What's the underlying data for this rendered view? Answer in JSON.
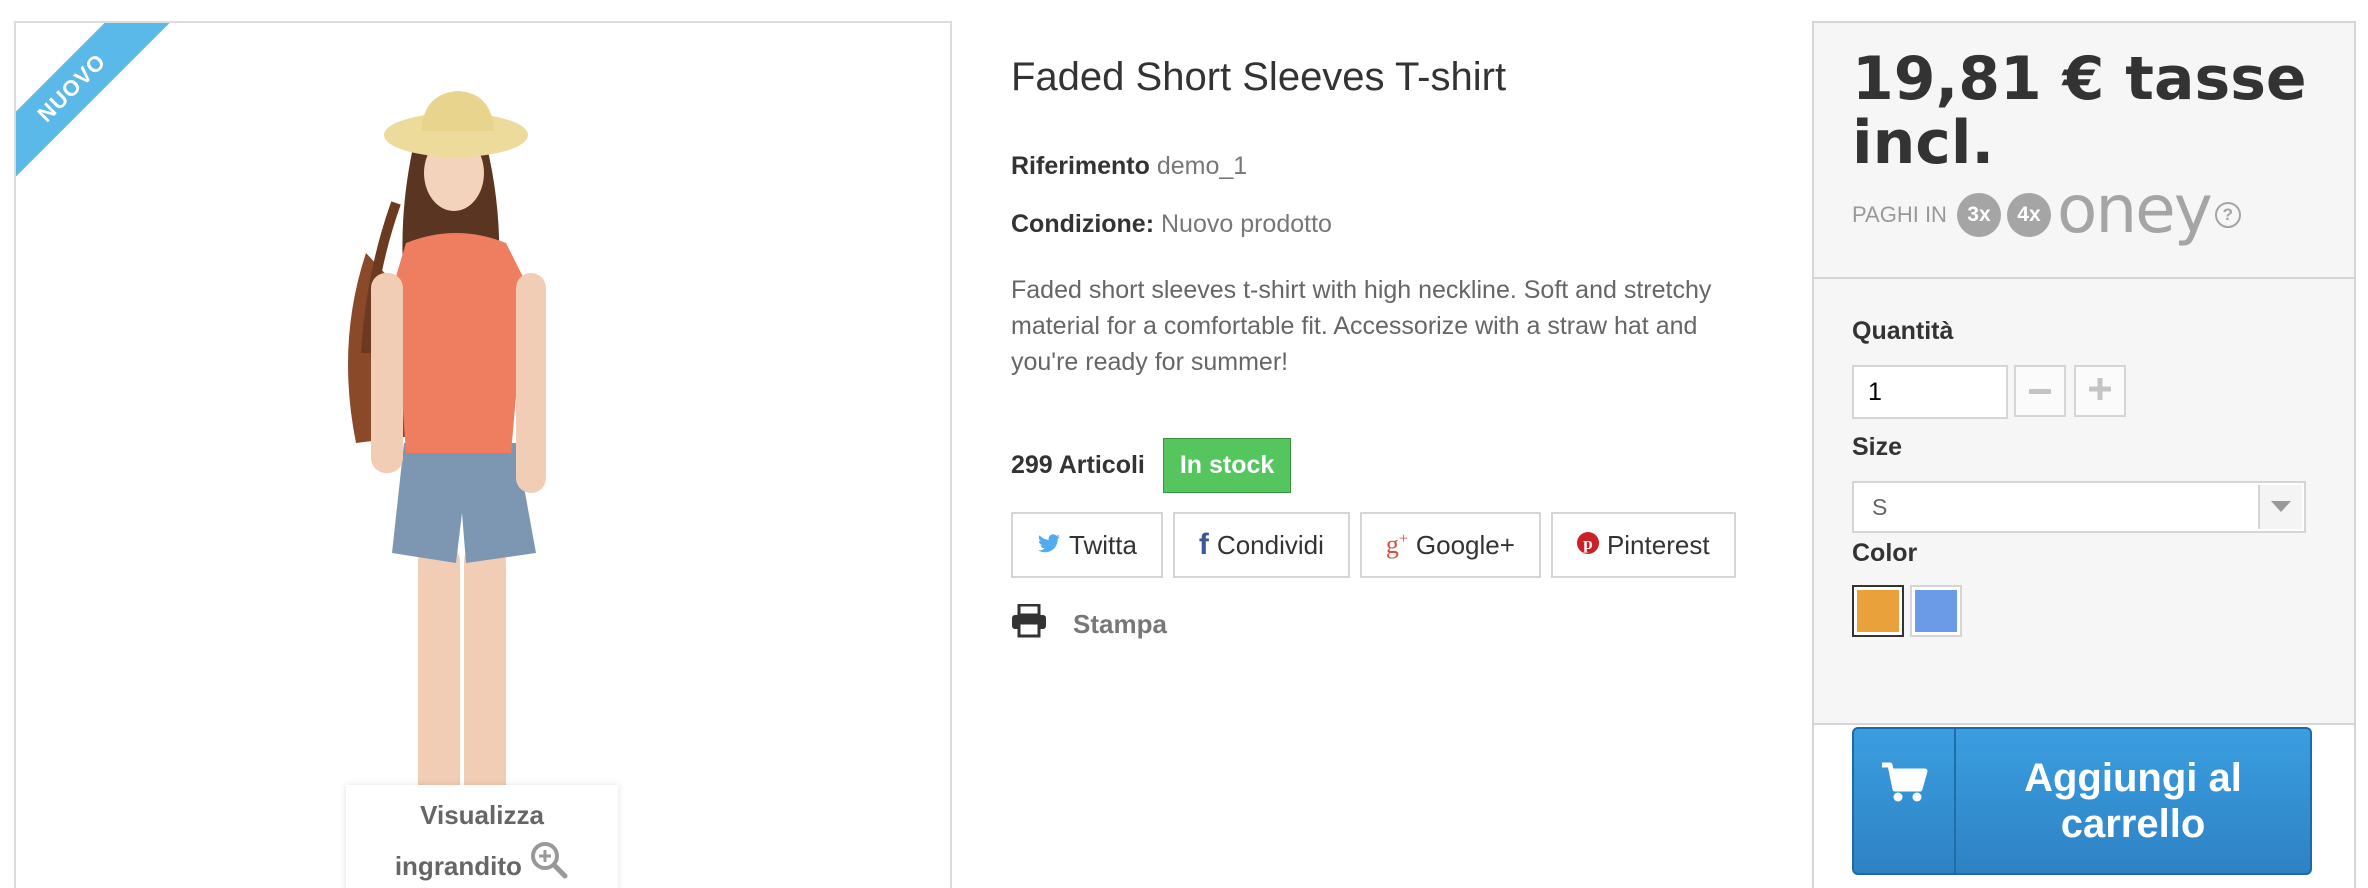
{
  "image": {
    "ribbon": "NUOVO",
    "zoom_line1": "Visualizza",
    "zoom_line2": "ingrandito"
  },
  "product": {
    "title": "Faded Short Sleeves T-shirt",
    "reference_label": "Riferimento",
    "reference_value": "demo_1",
    "condition_label": "Condizione:",
    "condition_value": "Nuovo prodotto",
    "description": "Faded short sleeves t-shirt with high neckline. Soft and stretchy material for a comfortable fit. Accessorize with a straw hat and you're ready for summer!",
    "quantity_text": "299 Articoli",
    "stock_badge": "In stock",
    "share": {
      "twitter": "Twitta",
      "facebook": "Condividi",
      "google": "Google+",
      "pinterest": "Pinterest"
    },
    "print_label": "Stampa"
  },
  "buy": {
    "price": "19,81 € tasse incl.",
    "pay_in": "PAGHI IN",
    "pay_3x": "3x",
    "pay_4x": "4x",
    "oney": "oney",
    "help": "?",
    "quantity_label": "Quantità",
    "quantity_value": "1",
    "size_label": "Size",
    "size_value": "S",
    "color_label": "Color",
    "colors": [
      "#e9a13b",
      "#6b9ae6"
    ],
    "cart_button": "Aggiungi al carrello"
  },
  "colors": {
    "ribbon": "#5bb9ea",
    "stock_green": "#55c65e",
    "cart_blue": "#2e8ed6",
    "twitter": "#50abf1",
    "facebook": "#3b5998",
    "google": "#dd4b39",
    "pinterest": "#cb2027"
  }
}
